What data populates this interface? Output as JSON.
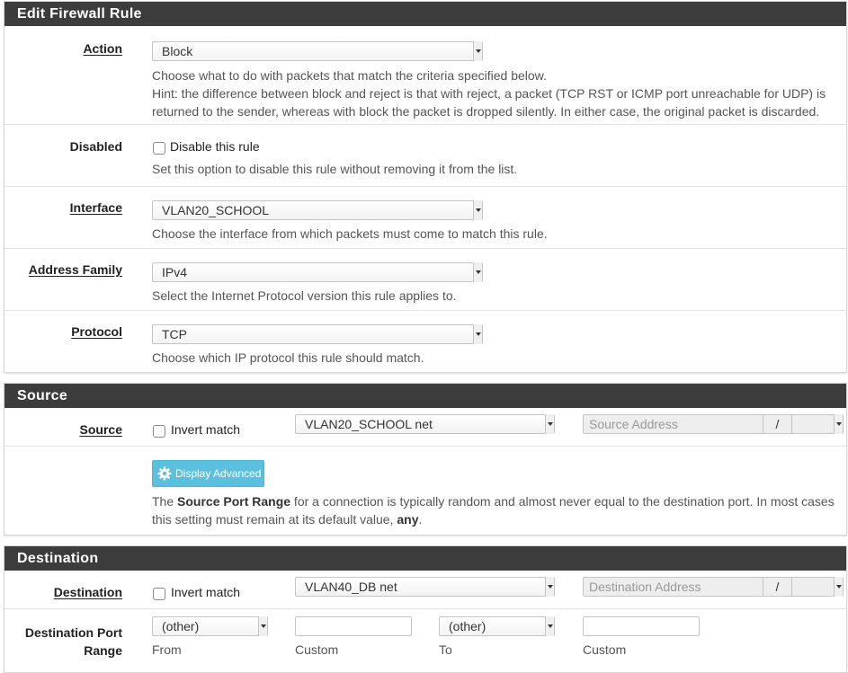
{
  "edit_panel": {
    "title": "Edit Firewall Rule",
    "action": {
      "label": "Action",
      "value": "Block",
      "help1": "Choose what to do with packets that match the criteria specified below.",
      "help2": "Hint: the difference between block and reject is that with reject, a packet (TCP RST or ICMP port unreachable for UDP) is",
      "help3": "returned to the sender, whereas with block the packet is dropped silently. In either case, the original packet is discarded."
    },
    "disabled": {
      "label": "Disabled",
      "checkbox_label": "Disable this rule",
      "help": "Set this option to disable this rule without removing it from the list."
    },
    "interface": {
      "label": "Interface",
      "value": "VLAN20_SCHOOL",
      "help": "Choose the interface from which packets must come to match this rule."
    },
    "address_family": {
      "label": "Address Family",
      "value": "IPv4",
      "help": "Select the Internet Protocol version this rule applies to."
    },
    "protocol": {
      "label": "Protocol",
      "value": "TCP",
      "help": "Choose which IP protocol this rule should match."
    }
  },
  "source_panel": {
    "title": "Source",
    "label": "Source",
    "invert_label": "Invert match",
    "type_value": "VLAN20_SCHOOL net",
    "address_placeholder": "Source Address",
    "slash": "/",
    "advanced_button": "Display Advanced",
    "help_pre": "The ",
    "help_bold1": "Source Port Range",
    "help_mid": " for a connection is typically random and almost never equal to the destination port. In most cases",
    "help_line2_pre": "this setting must remain at its default value, ",
    "help_bold2": "any",
    "help_end": "."
  },
  "destination_panel": {
    "title": "Destination",
    "label": "Destination",
    "invert_label": "Invert match",
    "type_value": "VLAN40_DB net",
    "address_placeholder": "Destination Address",
    "slash": "/",
    "port_range_label_line1": "Destination Port",
    "port_range_label_line2": "Range",
    "from_value": "(other)",
    "to_value": "(other)",
    "from_label": "From",
    "custom_label": "Custom",
    "to_label": "To",
    "custom_label2": "Custom"
  },
  "colors": {
    "panel_header": "#3c3c3c",
    "advanced_button": "#5bc0de"
  },
  "icons": [
    "gear-icon",
    "dropdown-arrow-icon"
  ]
}
